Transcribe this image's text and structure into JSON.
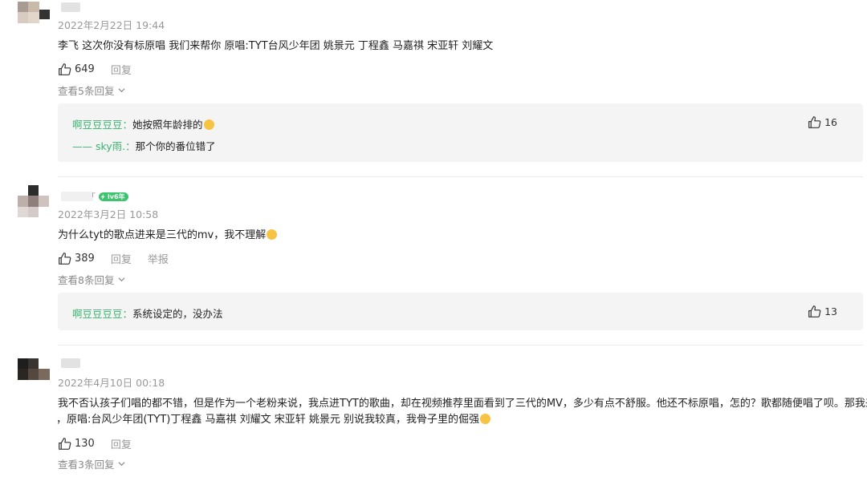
{
  "comments": [
    {
      "time": "2022年2月22日 19:44",
      "text": "李飞 这次你没有标原唱 我们来帮你 原唱:TYT台风少年团 姚景元 丁程鑫 马嘉祺 宋亚轩 刘耀文",
      "likes": "649",
      "reply_label": "回复",
      "more_replies": "查看5条回复",
      "replies": [
        {
          "name": "啊豆豆豆豆",
          "sep": "：",
          "text": "她按照年龄排的",
          "emoji": "grin",
          "likes": "16"
        },
        {
          "name": "—— sky雨.",
          "sep": "：",
          "text": "那个你的番位错了"
        }
      ]
    },
    {
      "time": "2022年3月2日 10:58",
      "level_badge": "lv6年",
      "name_fragment": "r",
      "text": "为什么tyt的歌点进来是三代的mv，我不理解",
      "emoji": "grin",
      "likes": "389",
      "reply_label": "回复",
      "report_label": "举报",
      "more_replies": "查看8条回复",
      "replies": [
        {
          "name": "啊豆豆豆豆",
          "sep": "：",
          "text": "系统设定的，没办法",
          "likes": "13"
        }
      ]
    },
    {
      "time": "2022年4月10日 00:18",
      "text_line1": "我不否认孩子们唱的都不错，但是作为一个老粉来说，我点进TYT的歌曲，却在视频推荐里面看到了三代的MV，多少有点不舒服。他还不标原唱，怎的？歌都随便唱了呗。那我来帮他标",
      "text_line2": "，原唱:台风少年团(TYT)丁程鑫 马嘉祺 刘耀文 宋亚轩 姚景元 别说我较真，我骨子里的倔强",
      "emoji": "grin",
      "likes": "130",
      "reply_label": "回复",
      "more_replies": "查看3条回复"
    }
  ],
  "colors": {
    "reply_name": "#3cb371",
    "badge": "#3cc46f",
    "reply_bg": "#f4f4f4"
  }
}
